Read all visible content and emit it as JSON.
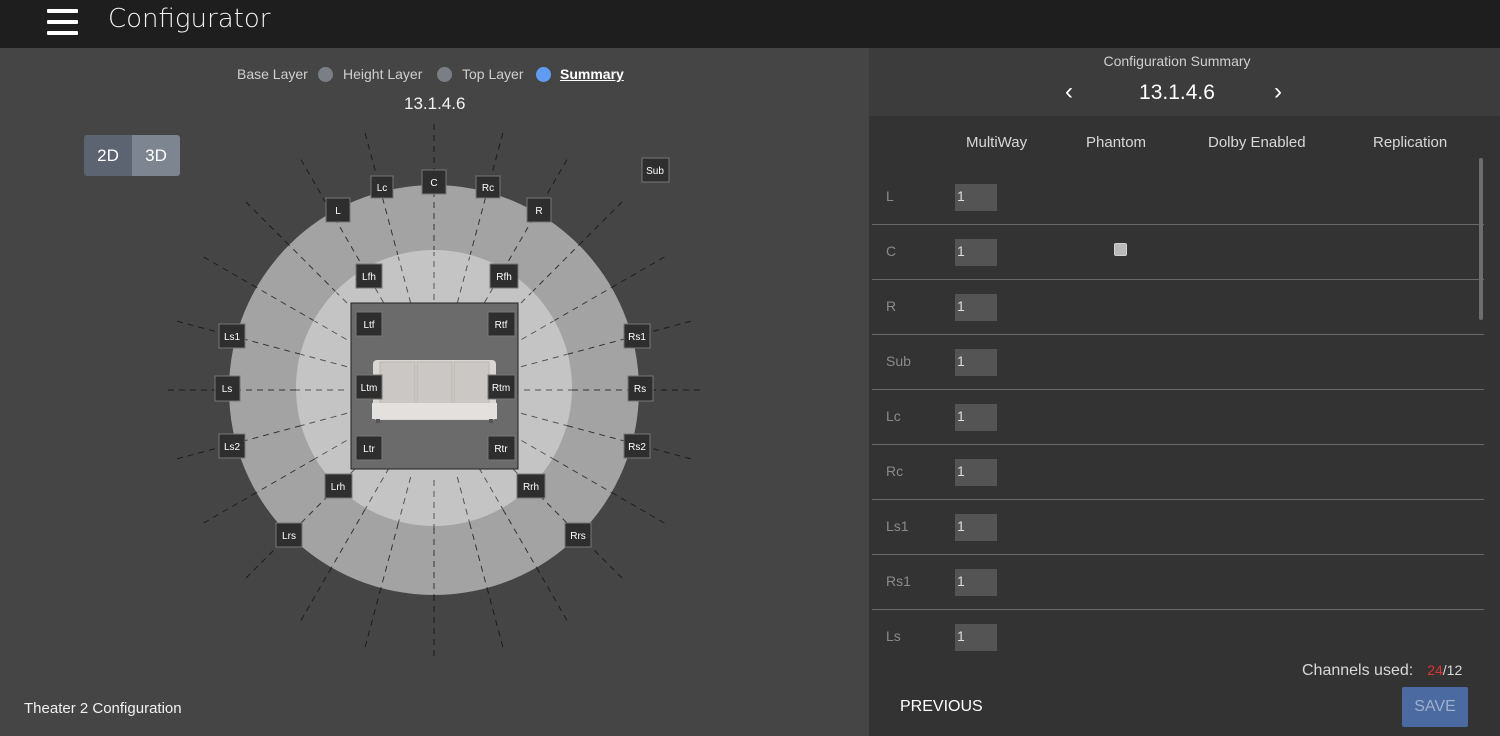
{
  "header": {
    "title": "Configurator",
    "menu_icon": "hamburger-menu-icon"
  },
  "layers": {
    "base": "Base Layer",
    "height": "Height Layer",
    "top": "Top Layer",
    "summary": "Summary",
    "active": "Summary"
  },
  "configuration": {
    "name": "13.1.4.6",
    "theater_label": "Theater 2 Configuration"
  },
  "view_toggle": {
    "two_d": "2D",
    "three_d": "3D"
  },
  "speakers": {
    "Lc": "Lc",
    "C": "C",
    "Rc": "Rc",
    "L": "L",
    "R": "R",
    "Sub": "Sub",
    "Lfh": "Lfh",
    "Rfh": "Rfh",
    "Ltf": "Ltf",
    "Rtf": "Rtf",
    "Ltm": "Ltm",
    "Rtm": "Rtm",
    "Ltr": "Ltr",
    "Rtr": "Rtr",
    "Ls1": "Ls1",
    "Rs1": "Rs1",
    "Ls": "Ls",
    "Rs": "Rs",
    "Ls2": "Ls2",
    "Rs2": "Rs2",
    "Lrh": "Lrh",
    "Rrh": "Rrh",
    "Lrs": "Lrs",
    "Rrs": "Rrs"
  },
  "summary_panel": {
    "title": "Configuration Summary",
    "value": "13.1.4.6",
    "prev_icon": "chevron-left-icon",
    "next_icon": "chevron-right-icon",
    "columns": [
      "MultiWay",
      "Phantom",
      "Dolby Enabled",
      "Replication"
    ],
    "rows": [
      {
        "label": "L",
        "multiway": "1",
        "phantom": false
      },
      {
        "label": "C",
        "multiway": "1",
        "phantom": true
      },
      {
        "label": "R",
        "multiway": "1",
        "phantom": false
      },
      {
        "label": "Sub",
        "multiway": "1",
        "phantom": false
      },
      {
        "label": "Lc",
        "multiway": "1",
        "phantom": false
      },
      {
        "label": "Rc",
        "multiway": "1",
        "phantom": false
      },
      {
        "label": "Ls1",
        "multiway": "1",
        "phantom": false
      },
      {
        "label": "Rs1",
        "multiway": "1",
        "phantom": false
      },
      {
        "label": "Ls",
        "multiway": "1",
        "phantom": false
      }
    ],
    "channels_label": "Channels used:",
    "channels_used": "24",
    "channels_total": "/12",
    "previous": "PREVIOUS",
    "save": "SAVE"
  },
  "colors": {
    "accent": "#5f9cf2",
    "warning": "#dd3333",
    "save_bg": "#4a6aa1"
  }
}
